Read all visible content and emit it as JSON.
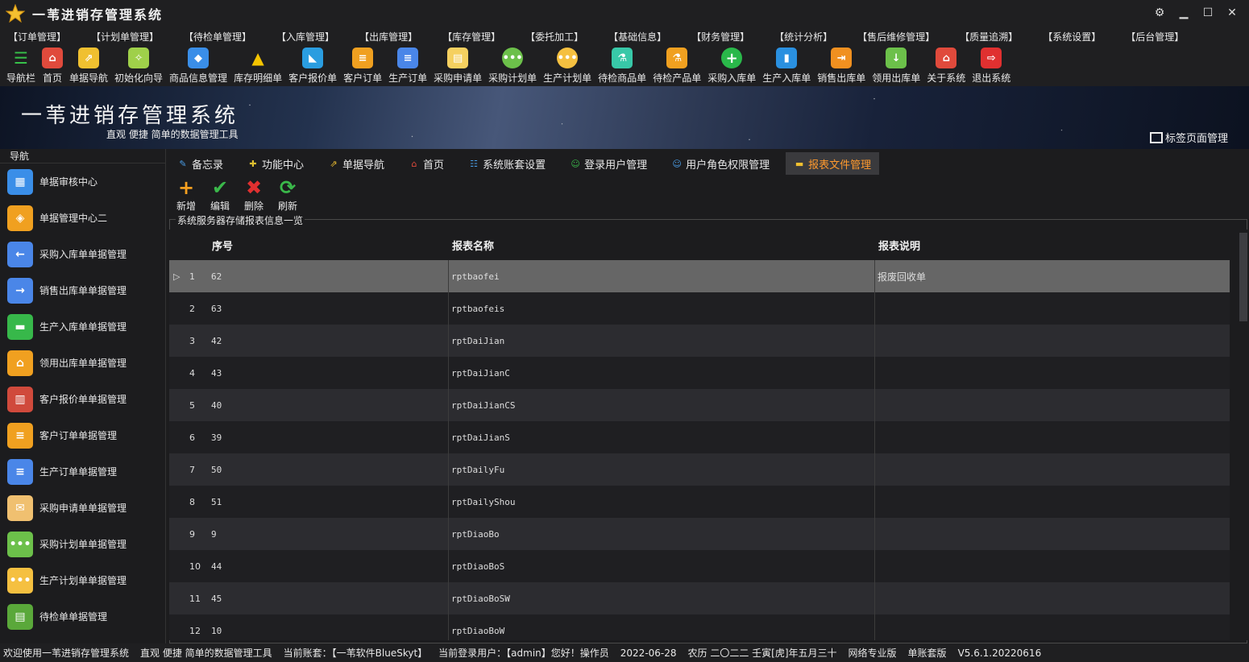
{
  "app": {
    "title": "一苇进销存管理系统",
    "banner_title": "一苇进销存管理系统",
    "banner_subtitle": "直观 便捷 简单的数据管理工具",
    "tab_manage_label": "标签页面管理"
  },
  "menu": [
    "【订单管理】",
    "【计划单管理】",
    "【待检单管理】",
    "【入库管理】",
    "【出库管理】",
    "【库存管理】",
    "【委托加工】",
    "【基础信息】",
    "【财务管理】",
    "【统计分析】",
    "【售后维修管理】",
    "【质量追溯】",
    "【系统设置】",
    "【后台管理】"
  ],
  "toolbar": [
    {
      "label": "导航栏",
      "icon": "menu-lines-icon",
      "color": "#37c24a"
    },
    {
      "label": "首页",
      "icon": "home-icon",
      "color": "#e04a3c"
    },
    {
      "label": "单据导航",
      "icon": "signpost-icon",
      "color": "#f0c030"
    },
    {
      "label": "初始化向导",
      "icon": "magic-wand-icon",
      "color": "#9fd04a"
    },
    {
      "label": "商品信息管理",
      "icon": "cubes-icon",
      "color": "#3a8ee8"
    },
    {
      "label": "库存明细单",
      "icon": "warning-icon",
      "color": "#f5c400"
    },
    {
      "label": "客户报价单",
      "icon": "tag-icon",
      "color": "#2a9de0"
    },
    {
      "label": "客户订单",
      "icon": "document-icon",
      "color": "#f0a020"
    },
    {
      "label": "生产订单",
      "icon": "document-icon",
      "color": "#4a86e8"
    },
    {
      "label": "采购申请单",
      "icon": "form-icon",
      "color": "#f5d060"
    },
    {
      "label": "采购计划单",
      "icon": "chat-dots-icon",
      "color": "#6cc04a"
    },
    {
      "label": "生产计划单",
      "icon": "chat-dots-icon",
      "color": "#f5c040"
    },
    {
      "label": "待检商品单",
      "icon": "flask-icon",
      "color": "#38c8a8"
    },
    {
      "label": "待检产品单",
      "icon": "beaker-icon",
      "color": "#f0a020"
    },
    {
      "label": "采购入库单",
      "icon": "plus-circle-icon",
      "color": "#2ab84a"
    },
    {
      "label": "生产入库单",
      "icon": "hand-truck-icon",
      "color": "#2a90e0"
    },
    {
      "label": "销售出库单",
      "icon": "exit-box-icon",
      "color": "#f09020"
    },
    {
      "label": "领用出库单",
      "icon": "download-icon",
      "color": "#6cc04a"
    },
    {
      "label": "关于系统",
      "icon": "house-icon",
      "color": "#e04a3c"
    },
    {
      "label": "退出系统",
      "icon": "logout-icon",
      "color": "#e03030"
    }
  ],
  "sidebar": {
    "title": "导航",
    "items": [
      {
        "label": "单据审核中心",
        "icon": "grid-apps-icon",
        "color": "#3a8ee8",
        "glyph": "▦"
      },
      {
        "label": "单据管理中心二",
        "icon": "shapes-icon",
        "color": "#f0a020",
        "glyph": "◈"
      },
      {
        "label": "采购入库单单据管理",
        "icon": "arrow-left-icon",
        "color": "#4a86e8",
        "glyph": "←"
      },
      {
        "label": "销售出库单单据管理",
        "icon": "arrow-right-icon",
        "color": "#4a86e8",
        "glyph": "→"
      },
      {
        "label": "生产入库单单据管理",
        "icon": "folder-icon",
        "color": "#37b84a",
        "glyph": "▬"
      },
      {
        "label": "领用出库单单据管理",
        "icon": "house-icon",
        "color": "#f0a020",
        "glyph": "⌂"
      },
      {
        "label": "客户报价单单据管理",
        "icon": "books-icon",
        "color": "#d04a3c",
        "glyph": "▥"
      },
      {
        "label": "客户订单单据管理",
        "icon": "document-icon",
        "color": "#f0a020",
        "glyph": "≡"
      },
      {
        "label": "生产订单单据管理",
        "icon": "document-icon",
        "color": "#4a86e8",
        "glyph": "≡"
      },
      {
        "label": "采购申请单单据管理",
        "icon": "envelope-icon",
        "color": "#f0c070",
        "glyph": "✉"
      },
      {
        "label": "采购计划单单据管理",
        "icon": "chat-dots-icon",
        "color": "#6cc04a",
        "glyph": "•••"
      },
      {
        "label": "生产计划单单据管理",
        "icon": "chat-dots-icon",
        "color": "#f5c040",
        "glyph": "•••"
      },
      {
        "label": "待检单单据管理",
        "icon": "form-icon",
        "color": "#5aa83a",
        "glyph": "▤"
      }
    ]
  },
  "tabs": [
    {
      "label": "备忘录",
      "icon": "memo-icon",
      "color": "#4a9ee8",
      "active": false
    },
    {
      "label": "功能中心",
      "icon": "puzzle-icon",
      "color": "#e0c030",
      "active": false
    },
    {
      "label": "单据导航",
      "icon": "signpost-icon",
      "color": "#f0c030",
      "active": false
    },
    {
      "label": "首页",
      "icon": "home-icon",
      "color": "#e04a3c",
      "active": false
    },
    {
      "label": "系统账套设置",
      "icon": "db-icon",
      "color": "#4a9ee8",
      "active": false
    },
    {
      "label": "登录用户管理",
      "icon": "users-icon",
      "color": "#3ab84a",
      "active": false
    },
    {
      "label": "用户角色权限管理",
      "icon": "user-icon",
      "color": "#4a9ee8",
      "active": false
    },
    {
      "label": "报表文件管理",
      "icon": "folder-icon",
      "color": "#f0c030",
      "active": true
    }
  ],
  "actions": [
    {
      "label": "新增",
      "glyph": "+",
      "color": "#f5a020"
    },
    {
      "label": "编辑",
      "glyph": "✔",
      "color": "#3ab84a"
    },
    {
      "label": "删除",
      "glyph": "✖",
      "color": "#e03030"
    },
    {
      "label": "刷新",
      "glyph": "⟳",
      "color": "#3ab84a"
    }
  ],
  "group_label": "系统服务器存储报表信息一览",
  "grid": {
    "headers": [
      "序号",
      "报表名称",
      "报表说明"
    ],
    "rows": [
      {
        "n": "1",
        "seq": "62",
        "name": "rptbaofei",
        "desc": "报废回收单"
      },
      {
        "n": "2",
        "seq": "63",
        "name": "rptbaofeis",
        "desc": ""
      },
      {
        "n": "3",
        "seq": "42",
        "name": "rptDaiJian",
        "desc": ""
      },
      {
        "n": "4",
        "seq": "43",
        "name": "rptDaiJianC",
        "desc": ""
      },
      {
        "n": "5",
        "seq": "40",
        "name": "rptDaiJianCS",
        "desc": ""
      },
      {
        "n": "6",
        "seq": "39",
        "name": "rptDaiJianS",
        "desc": ""
      },
      {
        "n": "7",
        "seq": "50",
        "name": "rptDailyFu",
        "desc": ""
      },
      {
        "n": "8",
        "seq": "51",
        "name": "rptDailyShou",
        "desc": ""
      },
      {
        "n": "9",
        "seq": "9",
        "name": "rptDiaoBo",
        "desc": ""
      },
      {
        "n": "10",
        "seq": "44",
        "name": "rptDiaoBoS",
        "desc": ""
      },
      {
        "n": "11",
        "seq": "45",
        "name": "rptDiaoBoSW",
        "desc": ""
      },
      {
        "n": "12",
        "seq": "10",
        "name": "rptDiaoBoW",
        "desc": ""
      }
    ]
  },
  "status": [
    "欢迎使用一苇进销存管理系统",
    "直观 便捷 简单的数据管理工具",
    "当前账套：【一苇软件BlueSkyt】",
    "当前登录用户：【admin】您好！操作员",
    "2022-06-28",
    "农历 二〇二二 壬寅[虎]年五月三十",
    "网络专业版",
    "单账套版",
    "V5.6.1.20220616"
  ]
}
